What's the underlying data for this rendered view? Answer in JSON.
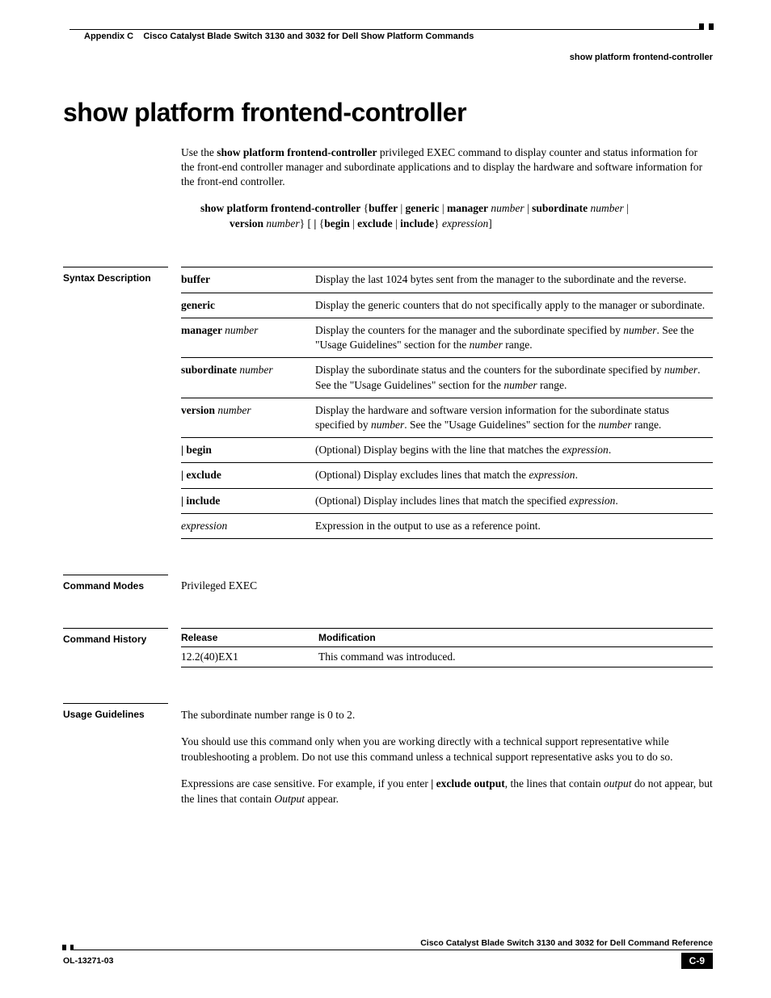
{
  "header": {
    "appendix": "Appendix C",
    "chapter": "Cisco Catalyst Blade Switch 3130 and 3032 for Dell Show Platform Commands",
    "running_head": "show platform frontend-controller"
  },
  "title": "show platform frontend-controller",
  "intro": {
    "p1_a": "Use the ",
    "p1_b": "show platform frontend-controller",
    "p1_c": " privileged EXEC command to display counter and status information for the front-end controller manager and subordinate applications and to display the hardware and software information for the front-end controller."
  },
  "syntax": {
    "cmd": "show platform frontend-controller",
    "line1_rest": " {buffer | generic | manager ",
    "num1": "number",
    "sub": " | subordinate ",
    "num2": "number",
    "pipe": " | ",
    "ver": "version ",
    "num3": "number",
    "mid": "} [ | {begin | exclude | include} ",
    "expr": "expression",
    "end": "]"
  },
  "sections": {
    "syntax_desc": "Syntax Description",
    "cmd_modes": "Command Modes",
    "cmd_history": "Command History",
    "usage": "Usage Guidelines"
  },
  "syntax_table": [
    {
      "k": "buffer",
      "ki": "",
      "d": "Display the last 1024 bytes sent from the manager to the subordinate and the reverse."
    },
    {
      "k": "generic",
      "ki": "",
      "d": "Display the generic counters that do not specifically apply to the manager or subordinate."
    },
    {
      "k": "manager ",
      "ki": "number",
      "d_pre": "Display the counters for the manager and the subordinate specified by ",
      "d_i1": "number",
      "d_mid": ". See the \"Usage Guidelines\" section for the ",
      "d_i2": "number",
      "d_post": " range."
    },
    {
      "k": "subordinate ",
      "ki": "number",
      "d_pre": "Display the subordinate status and the counters for the subordinate specified by ",
      "d_i1": "number",
      "d_mid": ". See the \"Usage Guidelines\" section for the ",
      "d_i2": "number",
      "d_post": " range."
    },
    {
      "k": "version ",
      "ki": "number",
      "d_pre": "Display the hardware and software version information for the subordinate status specified by ",
      "d_i1": "number",
      "d_mid": ". See the \"Usage Guidelines\" section for the ",
      "d_i2": "number",
      "d_post": " range."
    },
    {
      "k": "| begin",
      "ki": "",
      "d_pre": "(Optional) Display begins with the line that matches the ",
      "d_i1": "expression",
      "d_post": "."
    },
    {
      "k": "| exclude",
      "ki": "",
      "d_pre": "(Optional) Display excludes lines that match the ",
      "d_i1": "expression",
      "d_post": "."
    },
    {
      "k": "| include",
      "ki": "",
      "d_pre": "(Optional) Display includes lines that match the specified ",
      "d_i1": "expression",
      "d_post": "."
    },
    {
      "k": "",
      "ki": "expression",
      "d": "Expression in the output to use as a reference point."
    }
  ],
  "command_modes": "Privileged EXEC",
  "history": {
    "h_release": "Release",
    "h_mod": "Modification",
    "release": "12.2(40)EX1",
    "mod": "This command was introduced."
  },
  "usage": {
    "p1": "The subordinate number range is 0 to 2.",
    "p2": "You should use this command only when you are working directly with a technical support representative while troubleshooting a problem. Do not use this command unless a technical support representative asks you to do so.",
    "p3_a": "Expressions are case sensitive. For example, if you enter ",
    "p3_b": "| exclude output",
    "p3_c": ", the lines that contain ",
    "p3_d": "output",
    "p3_e": " do not appear, but the lines that contain ",
    "p3_f": "Output",
    "p3_g": " appear."
  },
  "footer": {
    "book": "Cisco Catalyst Blade Switch 3130 and 3032 for Dell Command Reference",
    "docid": "OL-13271-03",
    "page": "C-9"
  }
}
